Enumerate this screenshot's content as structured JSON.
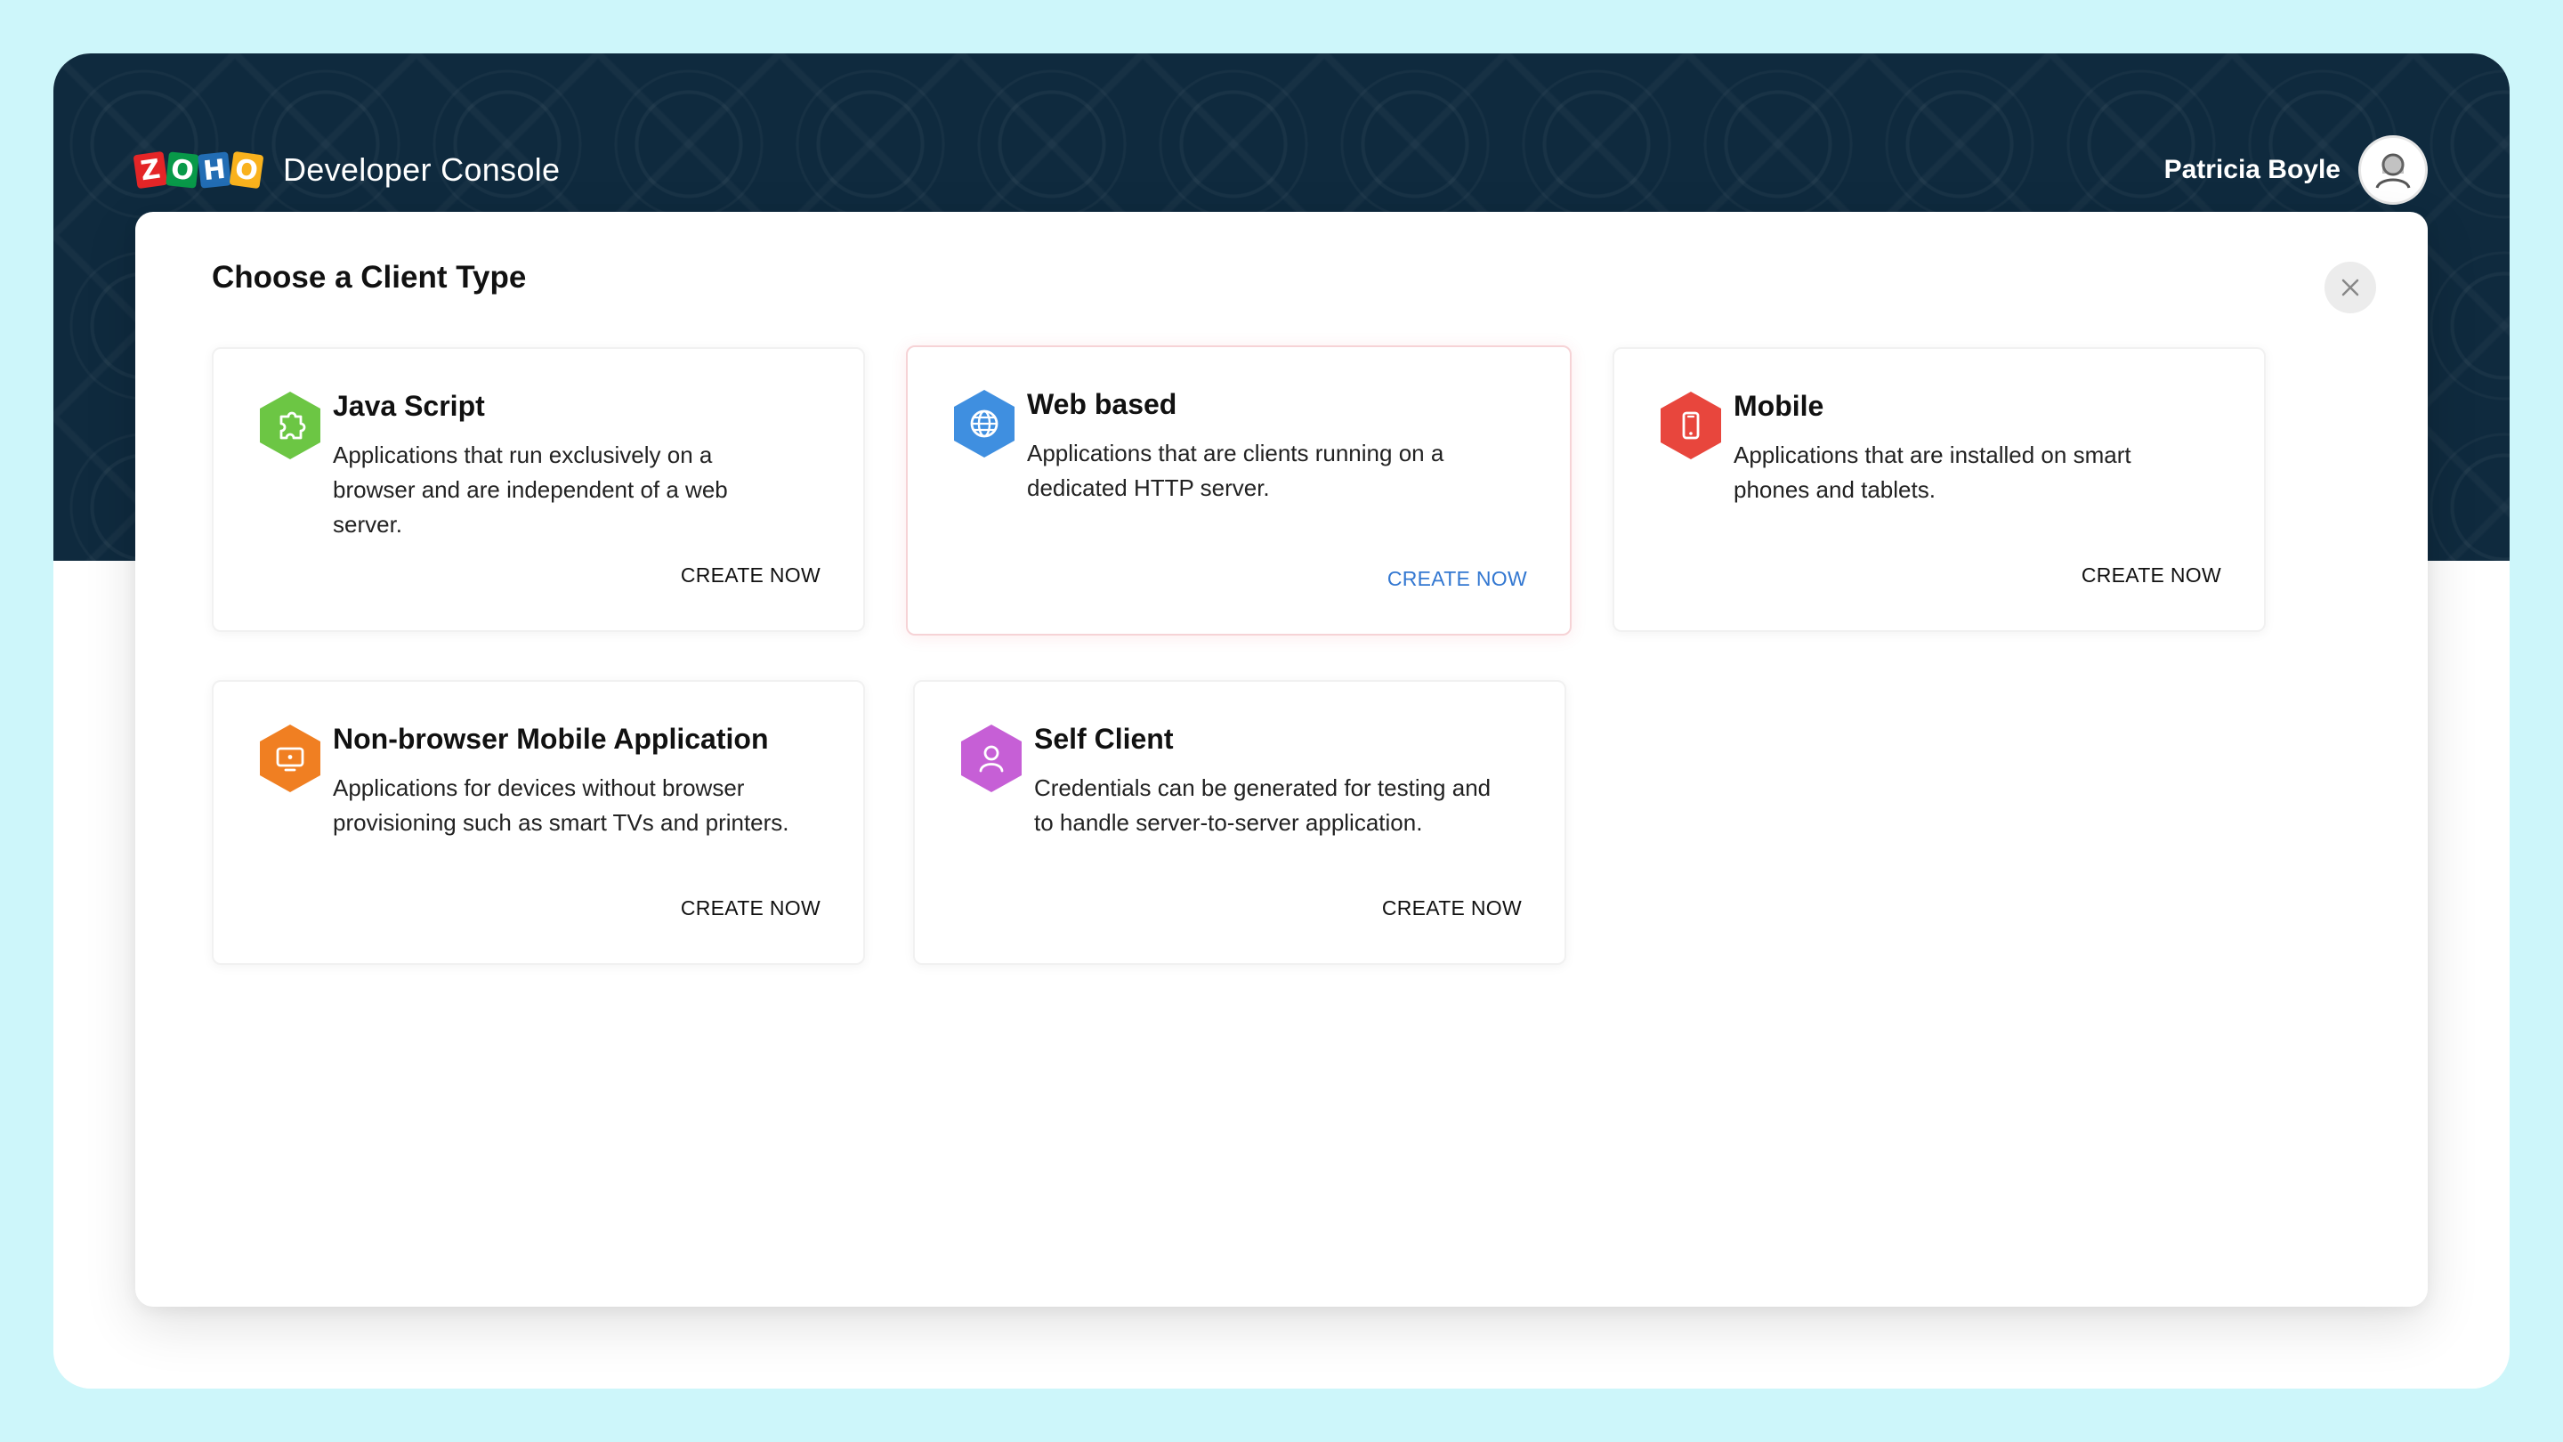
{
  "header": {
    "logo_letters": [
      "Z",
      "O",
      "H",
      "O"
    ],
    "app_title": "Developer Console",
    "user_name": "Patricia Boyle"
  },
  "modal": {
    "title": "Choose a Client Type",
    "close_icon": "close-icon"
  },
  "cards": [
    {
      "title": "Java Script",
      "description": "Applications that run exclusively on a browser and are independent of a web server.",
      "cta": "CREATE NOW",
      "icon": "puzzle-icon",
      "color": "#6cc644"
    },
    {
      "title": "Web based",
      "description": "Applications that are clients running on a dedicated HTTP server.",
      "cta": "CREATE NOW",
      "icon": "globe-icon",
      "color": "#3f8fe0"
    },
    {
      "title": "Mobile",
      "description": "Applications that are installed on smart phones and tablets.",
      "cta": "CREATE NOW",
      "icon": "phone-icon",
      "color": "#e8463d"
    },
    {
      "title": "Non-browser Mobile Application",
      "description": "Applications for devices without browser provisioning such as smart TVs and printers.",
      "cta": "CREATE NOW",
      "icon": "tv-icon",
      "color": "#f07f22"
    },
    {
      "title": "Self Client",
      "description": "Credentials can be generated for testing and to handle server-to-server application.",
      "cta": "CREATE NOW",
      "icon": "user-icon",
      "color": "#c65fd6"
    }
  ],
  "colors": {
    "page_background": "#cdf6fa",
    "header_background": "#0f2a3e",
    "active_link": "#3277d1"
  }
}
